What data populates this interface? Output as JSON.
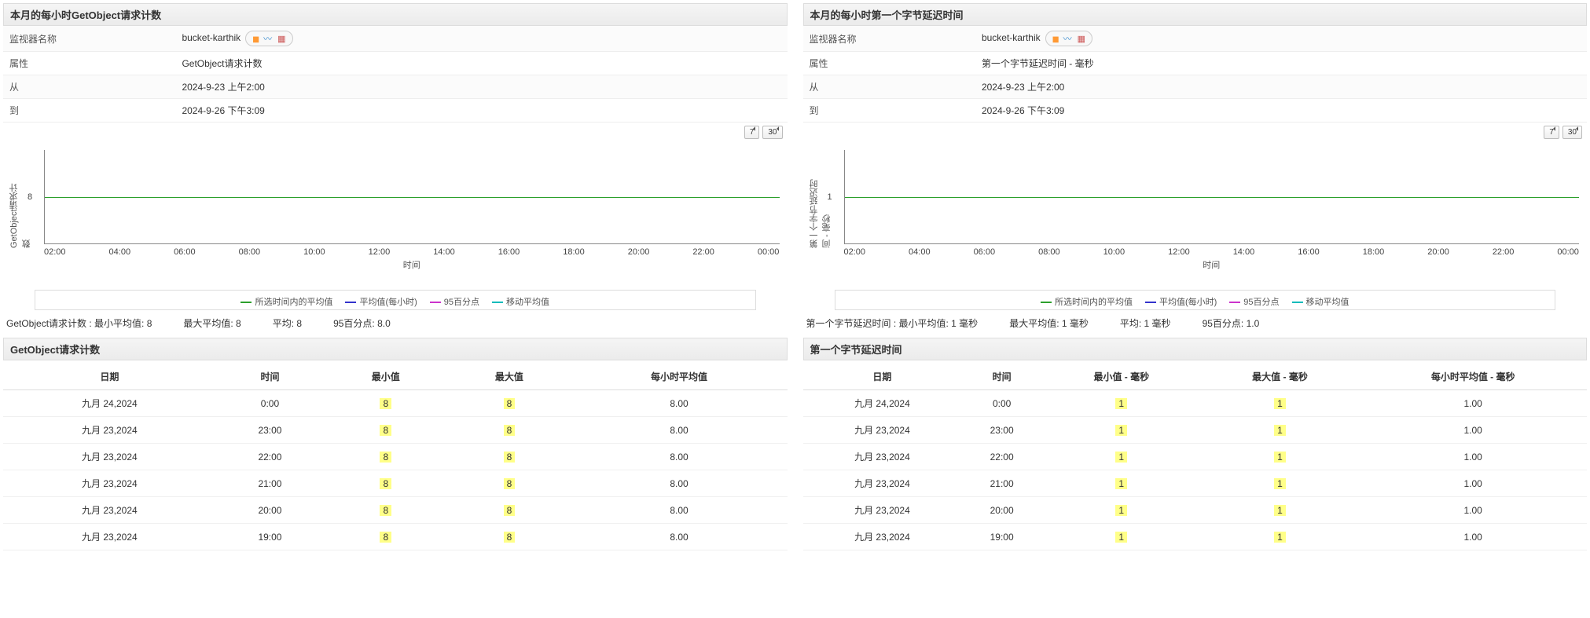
{
  "panels": [
    {
      "header": "本月的每小时GetObject请求计数",
      "info": {
        "monitor_label": "监视器名称",
        "monitor_value": "bucket-karthik",
        "attr_label": "属性",
        "attr_value": "GetObject请求计数",
        "from_label": "从",
        "from_value": "2024-9-23 上午2:00",
        "to_label": "到",
        "to_value": "2024-9-26 下午3:09"
      },
      "toolbar": {
        "btn7": "7",
        "btn30": "30"
      },
      "chart": {
        "y_label": "GetObject请求计数",
        "y_tick": "8",
        "x_label": "时间",
        "x_ticks": [
          "02:00",
          "04:00",
          "06:00",
          "08:00",
          "10:00",
          "12:00",
          "14:00",
          "16:00",
          "18:00",
          "20:00",
          "22:00",
          "00:00"
        ],
        "legend": [
          {
            "label": "所选时间内的平均值",
            "color": "#2ca02c"
          },
          {
            "label": "平均值(每小时)",
            "color": "#3333cc"
          },
          {
            "label": "95百分点",
            "color": "#cc33cc"
          },
          {
            "label": "移动平均值",
            "color": "#00bbbb"
          }
        ]
      },
      "stats": {
        "min_label": "GetObject请求计数 : 最小平均值:",
        "min_val": "8",
        "max_label": "最大平均值:",
        "max_val": "8",
        "avg_label": "平均:",
        "avg_val": "8",
        "p95_label": "95百分点:",
        "p95_val": "8.0"
      },
      "table": {
        "header": "GetObject请求计数",
        "cols": [
          "日期",
          "时间",
          "最小值",
          "最大值",
          "每小时平均值"
        ],
        "rows": [
          [
            "九月 24,2024",
            "0:00",
            "8",
            "8",
            "8.00"
          ],
          [
            "九月 23,2024",
            "23:00",
            "8",
            "8",
            "8.00"
          ],
          [
            "九月 23,2024",
            "22:00",
            "8",
            "8",
            "8.00"
          ],
          [
            "九月 23,2024",
            "21:00",
            "8",
            "8",
            "8.00"
          ],
          [
            "九月 23,2024",
            "20:00",
            "8",
            "8",
            "8.00"
          ],
          [
            "九月 23,2024",
            "19:00",
            "8",
            "8",
            "8.00"
          ]
        ]
      }
    },
    {
      "header": "本月的每小时第一个字节延迟时间",
      "info": {
        "monitor_label": "监视器名称",
        "monitor_value": "bucket-karthik",
        "attr_label": "属性",
        "attr_value": "第一个字节延迟时间 - 毫秒",
        "from_label": "从",
        "from_value": "2024-9-23 上午2:00",
        "to_label": "到",
        "to_value": "2024-9-26 下午3:09"
      },
      "toolbar": {
        "btn7": "7",
        "btn30": "30"
      },
      "chart": {
        "y_label": "第一个字节延迟时间 - 毫秒",
        "y_tick": "1",
        "x_label": "时间",
        "x_ticks": [
          "02:00",
          "04:00",
          "06:00",
          "08:00",
          "10:00",
          "12:00",
          "14:00",
          "16:00",
          "18:00",
          "20:00",
          "22:00",
          "00:00"
        ],
        "legend": [
          {
            "label": "所选时间内的平均值",
            "color": "#2ca02c"
          },
          {
            "label": "平均值(每小时)",
            "color": "#3333cc"
          },
          {
            "label": "95百分点",
            "color": "#cc33cc"
          },
          {
            "label": "移动平均值",
            "color": "#00bbbb"
          }
        ]
      },
      "stats": {
        "min_label": "第一个字节延迟时间 : 最小平均值:",
        "min_val": "1  毫秒",
        "max_label": "最大平均值:",
        "max_val": "1  毫秒",
        "avg_label": "平均:",
        "avg_val": "1  毫秒",
        "p95_label": "95百分点:",
        "p95_val": "1.0"
      },
      "table": {
        "header": "第一个字节延迟时间",
        "cols": [
          "日期",
          "时间",
          "最小值 - 毫秒",
          "最大值 - 毫秒",
          "每小时平均值 - 毫秒"
        ],
        "rows": [
          [
            "九月 24,2024",
            "0:00",
            "1",
            "1",
            "1.00"
          ],
          [
            "九月 23,2024",
            "23:00",
            "1",
            "1",
            "1.00"
          ],
          [
            "九月 23,2024",
            "22:00",
            "1",
            "1",
            "1.00"
          ],
          [
            "九月 23,2024",
            "21:00",
            "1",
            "1",
            "1.00"
          ],
          [
            "九月 23,2024",
            "20:00",
            "1",
            "1",
            "1.00"
          ],
          [
            "九月 23,2024",
            "19:00",
            "1",
            "1",
            "1.00"
          ]
        ]
      }
    }
  ],
  "chart_data": [
    {
      "type": "line",
      "title": "本月的每小时GetObject请求计数",
      "xlabel": "时间",
      "ylabel": "GetObject请求计数",
      "x": [
        "02:00",
        "04:00",
        "06:00",
        "08:00",
        "10:00",
        "12:00",
        "14:00",
        "16:00",
        "18:00",
        "20:00",
        "22:00",
        "00:00"
      ],
      "series": [
        {
          "name": "所选时间内的平均值",
          "values": [
            8,
            8,
            8,
            8,
            8,
            8,
            8,
            8,
            8,
            8,
            8,
            8
          ]
        },
        {
          "name": "平均值(每小时)",
          "values": [
            8,
            8,
            8,
            8,
            8,
            8,
            8,
            8,
            8,
            8,
            8,
            8
          ]
        },
        {
          "name": "95百分点",
          "values": [
            8,
            8,
            8,
            8,
            8,
            8,
            8,
            8,
            8,
            8,
            8,
            8
          ]
        },
        {
          "name": "移动平均值",
          "values": [
            8,
            8,
            8,
            8,
            8,
            8,
            8,
            8,
            8,
            8,
            8,
            8
          ]
        }
      ],
      "ylim": [
        0,
        16
      ]
    },
    {
      "type": "line",
      "title": "本月的每小时第一个字节延迟时间",
      "xlabel": "时间",
      "ylabel": "第一个字节延迟时间 - 毫秒",
      "x": [
        "02:00",
        "04:00",
        "06:00",
        "08:00",
        "10:00",
        "12:00",
        "14:00",
        "16:00",
        "18:00",
        "20:00",
        "22:00",
        "00:00"
      ],
      "series": [
        {
          "name": "所选时间内的平均值",
          "values": [
            1,
            1,
            1,
            1,
            1,
            1,
            1,
            1,
            1,
            1,
            1,
            1
          ]
        },
        {
          "name": "平均值(每小时)",
          "values": [
            1,
            1,
            1,
            1,
            1,
            1,
            1,
            1,
            1,
            1,
            1,
            1
          ]
        },
        {
          "name": "95百分点",
          "values": [
            1,
            1,
            1,
            1,
            1,
            1,
            1,
            1,
            1,
            1,
            1,
            1
          ]
        },
        {
          "name": "移动平均值",
          "values": [
            1,
            1,
            1,
            1,
            1,
            1,
            1,
            1,
            1,
            1,
            1,
            1
          ]
        }
      ],
      "ylim": [
        0,
        2
      ]
    }
  ]
}
